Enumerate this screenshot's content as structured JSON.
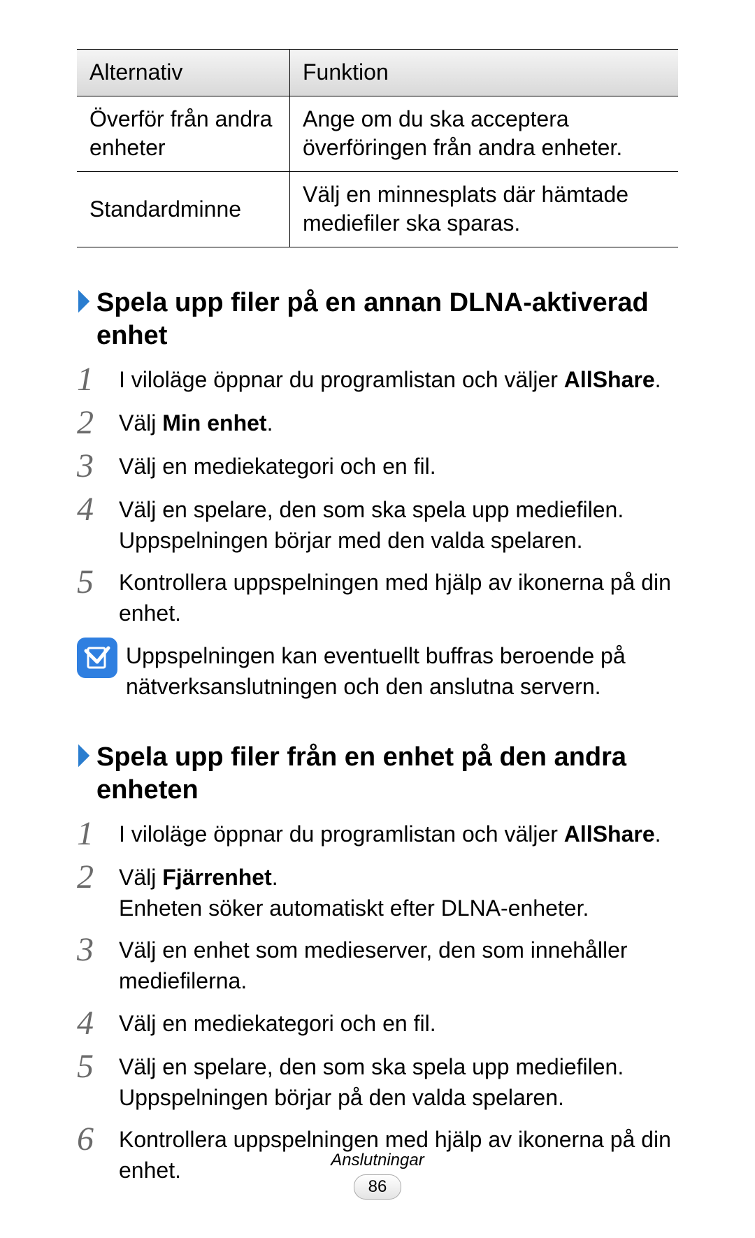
{
  "table": {
    "head": {
      "c0": "Alternativ",
      "c1": "Funktion"
    },
    "rows": [
      {
        "c0": "Överför från andra enheter",
        "c1": "Ange om du ska acceptera överföringen från andra enheter."
      },
      {
        "c0": "Standardminne",
        "c1": "Välj en minnesplats där hämtade mediefiler ska sparas."
      }
    ]
  },
  "section1": {
    "title": "Spela upp filer på en annan DLNA-aktiverad enhet",
    "steps": {
      "s1a": "I viloläge öppnar du programlistan och väljer ",
      "s1b": "AllShare",
      "s1c": ".",
      "s2a": "Välj ",
      "s2b": "Min enhet",
      "s2c": ".",
      "s3": "Välj en mediekategori och en fil.",
      "s4": "Välj en spelare, den som ska spela upp mediefilen. Uppspelningen börjar med den valda spelaren.",
      "s5": "Kontrollera uppspelningen med hjälp av ikonerna på din enhet."
    },
    "note": "Uppspelningen kan eventuellt buffras beroende på nätverksanslutningen och den anslutna servern."
  },
  "section2": {
    "title": "Spela upp filer från en enhet på den andra enheten",
    "steps": {
      "s1a": "I viloläge öppnar du programlistan och väljer ",
      "s1b": "AllShare",
      "s1c": ".",
      "s2a": "Välj ",
      "s2b": "Fjärrenhet",
      "s2c": ".",
      "s2d": "Enheten söker automatiskt efter DLNA-enheter.",
      "s3": "Välj en enhet som medieserver, den som innehåller mediefilerna.",
      "s4": "Välj en mediekategori och en fil.",
      "s5": "Välj en spelare, den som ska spela upp mediefilen. Uppspelningen börjar på den valda spelaren.",
      "s6": "Kontrollera uppspelningen med hjälp av ikonerna på din enhet."
    }
  },
  "nums": {
    "n1": "1",
    "n2": "2",
    "n3": "3",
    "n4": "4",
    "n5": "5",
    "n6": "6"
  },
  "footer": {
    "section": "Anslutningar",
    "page": "86"
  }
}
